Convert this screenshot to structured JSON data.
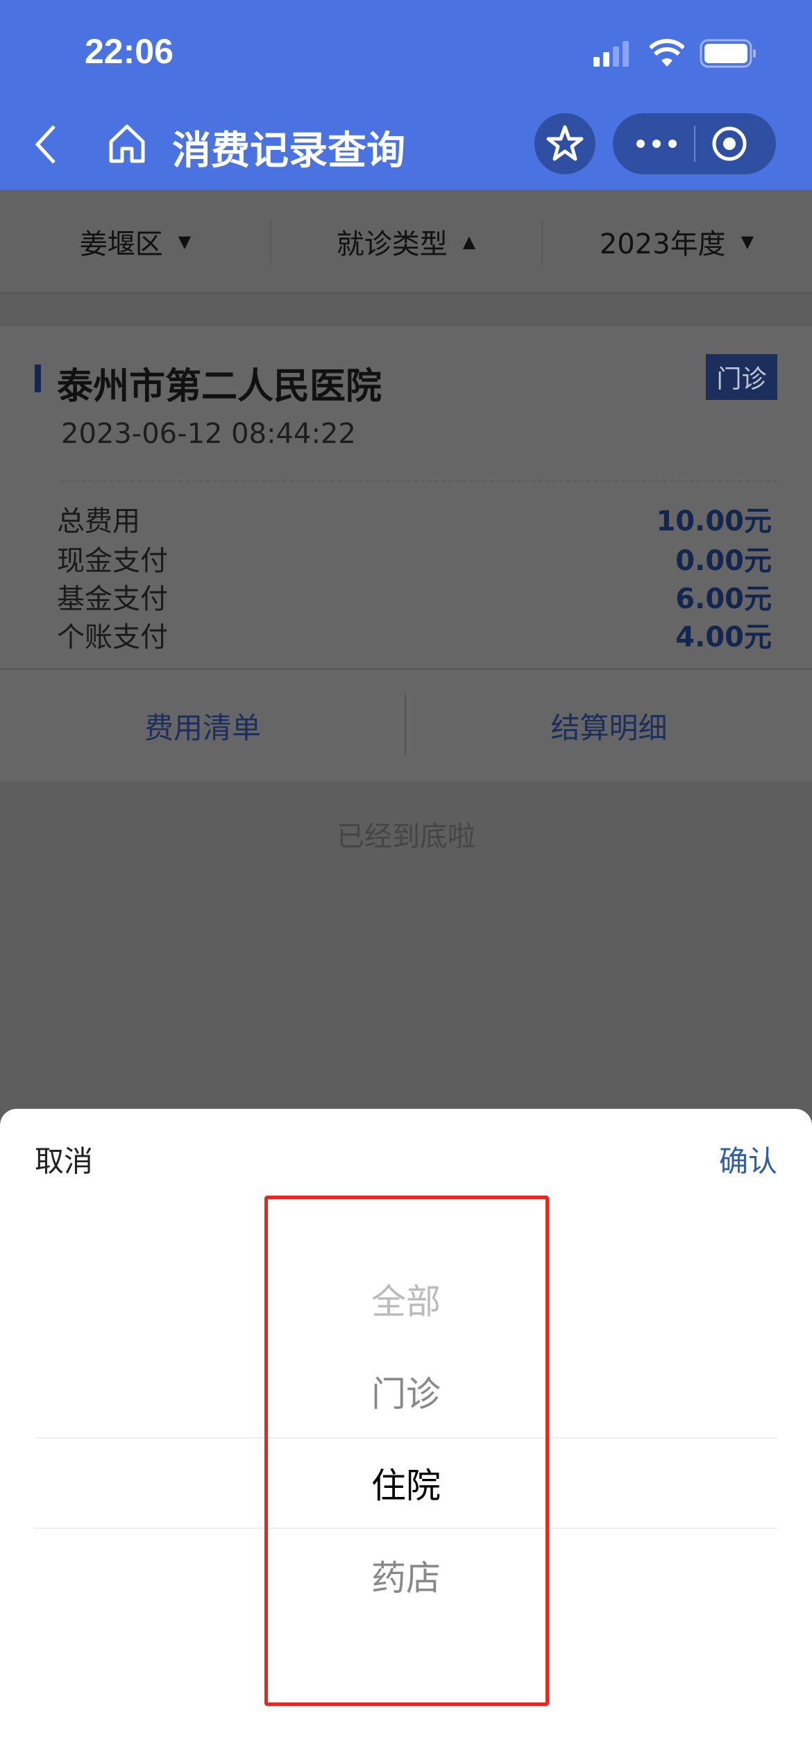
{
  "status_bar": {
    "time": "22:06"
  },
  "nav": {
    "title": "消费记录查询"
  },
  "filters": [
    {
      "label": "姜堰区",
      "arrow": "down"
    },
    {
      "label": "就诊类型",
      "arrow": "up"
    },
    {
      "label": "2023年度",
      "arrow": "down"
    }
  ],
  "record": {
    "hospital": "泰州市第二人民医院",
    "badge": "门诊",
    "datetime": "2023-06-12 08:44:22",
    "rows": [
      {
        "label": "总费用",
        "value": "10.00元"
      },
      {
        "label": "现金支付",
        "value": "0.00元"
      },
      {
        "label": "基金支付",
        "value": "6.00元"
      },
      {
        "label": "个账支付",
        "value": "4.00元"
      }
    ],
    "actions": {
      "fee_list": "费用清单",
      "settlement": "结算明细"
    }
  },
  "end_text": "已经到底啦",
  "picker": {
    "cancel": "取消",
    "confirm": "确认",
    "options": [
      "全部",
      "门诊",
      "住院",
      "药店"
    ],
    "selected": "住院"
  },
  "colors": {
    "brand": "#4a72e0",
    "accent": "#1f3a7a",
    "confirm": "#2f5ea8",
    "highlight_box": "#e8281e"
  }
}
